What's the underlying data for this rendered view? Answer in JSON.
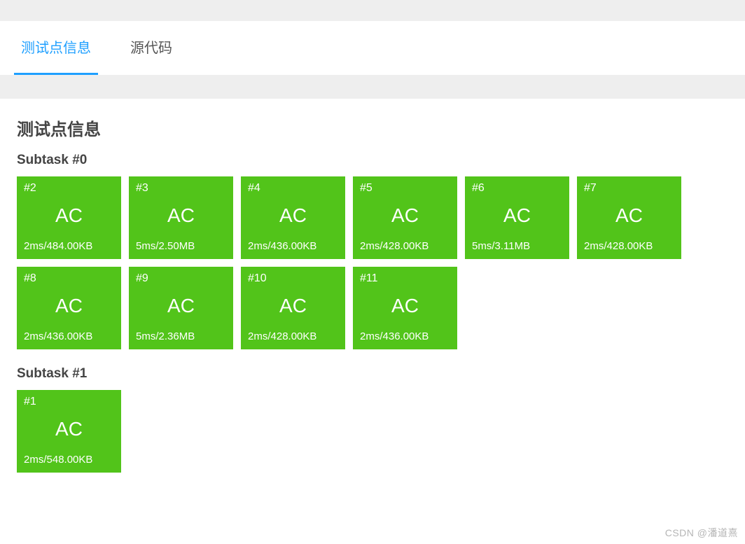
{
  "tabs": [
    {
      "label": "测试点信息",
      "active": true
    },
    {
      "label": "源代码",
      "active": false
    }
  ],
  "section_title": "测试点信息",
  "subtasks": [
    {
      "title": "Subtask #0",
      "cards": [
        {
          "num": "#2",
          "status": "AC",
          "stats": "2ms/484.00KB"
        },
        {
          "num": "#3",
          "status": "AC",
          "stats": "5ms/2.50MB"
        },
        {
          "num": "#4",
          "status": "AC",
          "stats": "2ms/436.00KB"
        },
        {
          "num": "#5",
          "status": "AC",
          "stats": "2ms/428.00KB"
        },
        {
          "num": "#6",
          "status": "AC",
          "stats": "5ms/3.11MB"
        },
        {
          "num": "#7",
          "status": "AC",
          "stats": "2ms/428.00KB"
        },
        {
          "num": "#8",
          "status": "AC",
          "stats": "2ms/436.00KB"
        },
        {
          "num": "#9",
          "status": "AC",
          "stats": "5ms/2.36MB"
        },
        {
          "num": "#10",
          "status": "AC",
          "stats": "2ms/428.00KB"
        },
        {
          "num": "#11",
          "status": "AC",
          "stats": "2ms/436.00KB"
        }
      ]
    },
    {
      "title": "Subtask #1",
      "cards": [
        {
          "num": "#1",
          "status": "AC",
          "stats": "2ms/548.00KB"
        }
      ]
    }
  ],
  "watermark": "CSDN @潘道熹",
  "colors": {
    "accent": "#1e9fff",
    "card_bg": "#52c41a"
  }
}
